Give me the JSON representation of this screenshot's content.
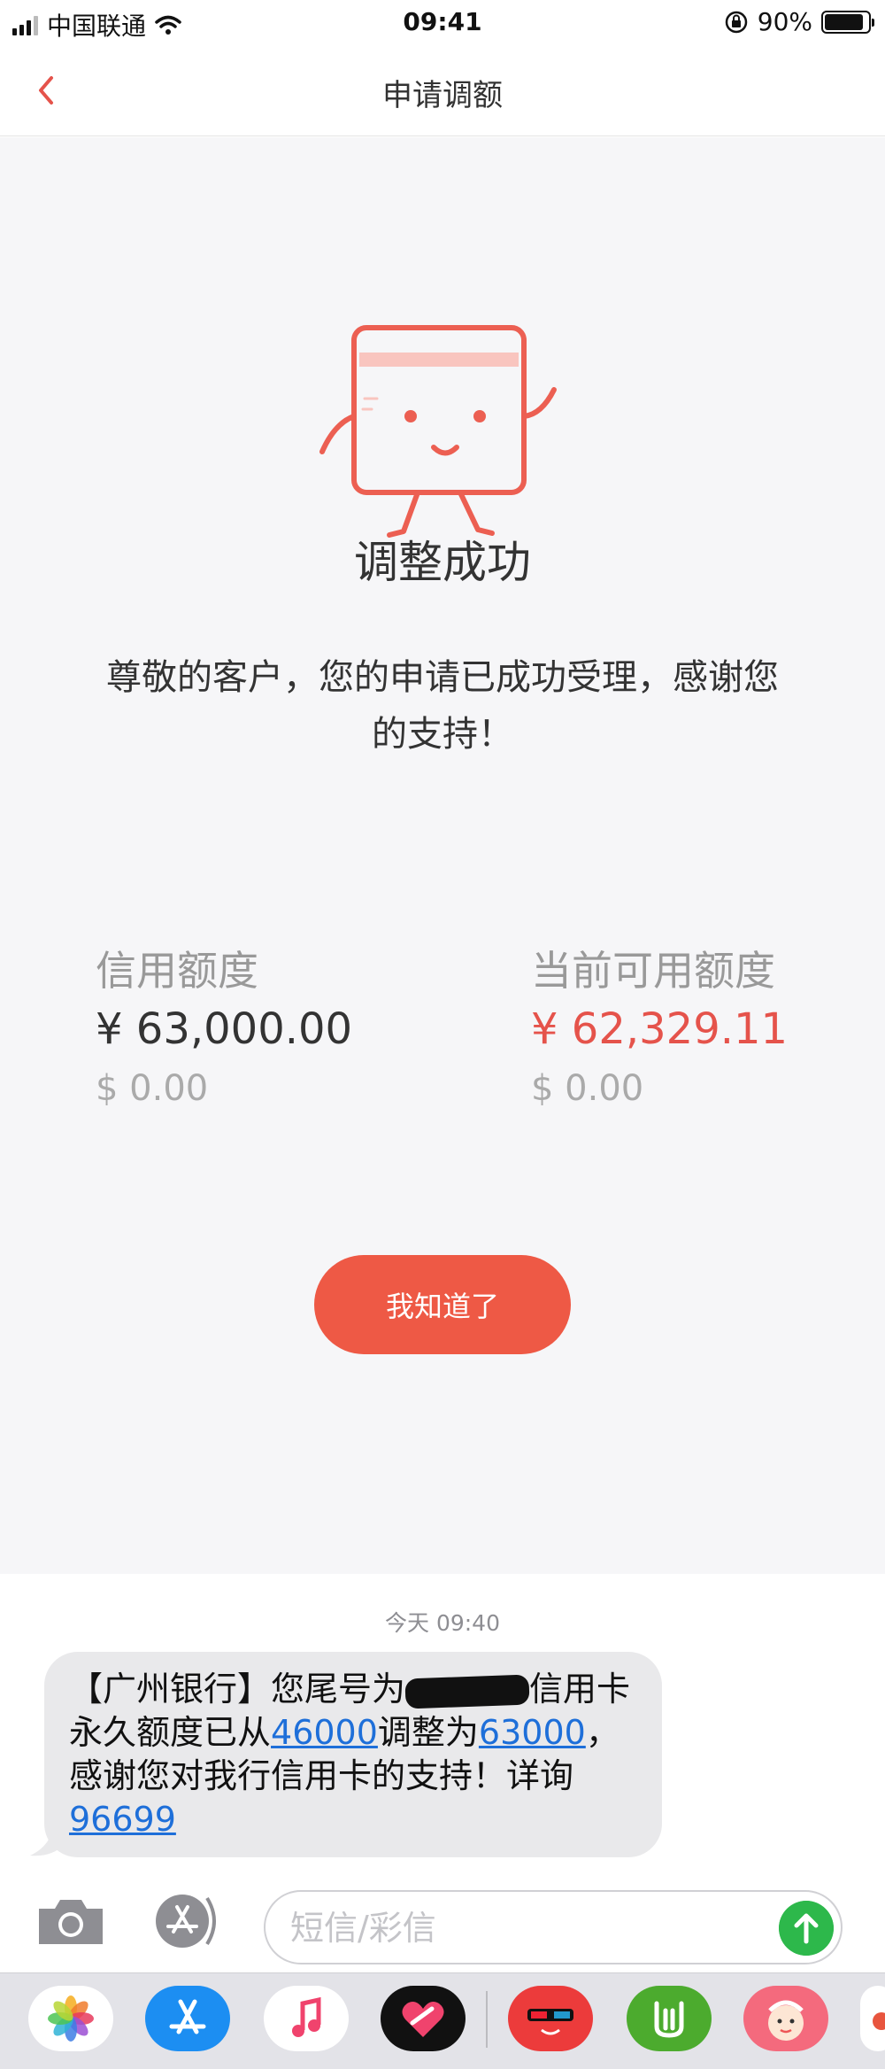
{
  "status_bar": {
    "carrier": "中国联通",
    "time": "09:41",
    "battery": "90%",
    "battery_level": 0.9
  },
  "nav": {
    "title": "申请调额"
  },
  "result": {
    "title": "调整成功",
    "message": "尊敬的客户，您的申请已成功受理，感谢您的支持！"
  },
  "credit": {
    "limit_label": "信用额度",
    "limit_amount": "¥ 63,000.00",
    "limit_usd": "$ 0.00",
    "available_label": "当前可用额度",
    "available_amount": "¥ 62,329.11",
    "available_usd": "$ 0.00"
  },
  "button": {
    "ok_label": "我知道了"
  },
  "messages": {
    "timestamp": "今天 09:40",
    "sms": {
      "part1": "【广州银行】您尾号为",
      "part2": "信用卡永久额度已从",
      "from_amount": "46000",
      "part3": "调整为",
      "to_amount": "63000",
      "part4": "，感谢您对我行信用卡的支持！详询",
      "phone": "96699"
    }
  },
  "composer": {
    "placeholder": "短信/彩信"
  },
  "colors": {
    "accent_red": "#ee5945",
    "available_red": "#e5534b",
    "link_blue": "#1e6fd9",
    "send_green": "#2db84b"
  },
  "icons": {
    "back": "chevron-left-icon",
    "camera": "camera-icon",
    "apps": "app-store-icon",
    "send": "arrow-up-icon",
    "tray": [
      "photos-icon",
      "app-store-icon",
      "music-icon",
      "heart-app-icon",
      "red-glasses-app-icon",
      "green-app-icon",
      "baby-app-icon"
    ]
  }
}
